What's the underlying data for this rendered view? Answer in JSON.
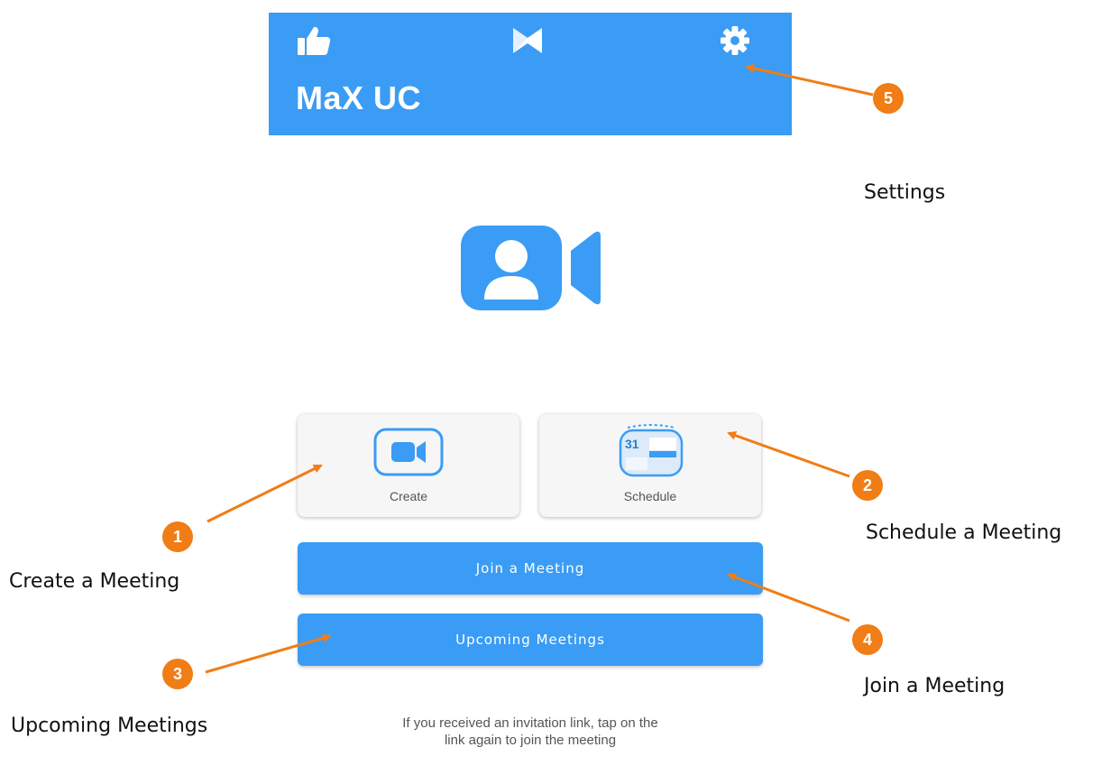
{
  "header": {
    "title": "MaX UC",
    "icons": [
      "thumbs-up-icon",
      "max-logo-icon",
      "gear-icon"
    ],
    "background": "#3a9cf4"
  },
  "hero_icon": "video-contact-icon",
  "cards": [
    {
      "label": "Create",
      "icon": "video-camera-icon"
    },
    {
      "label": "Schedule",
      "icon": "calendar-icon",
      "calendar_day": "31"
    }
  ],
  "buttons": {
    "join": "Join a Meeting",
    "upcoming": "Upcoming Meetings"
  },
  "hint": {
    "line1": "If you received an invitation link, tap on the",
    "line2": "link again to join the meeting"
  },
  "annotations": [
    {
      "number": "1",
      "label": "Create a Meeting"
    },
    {
      "number": "2",
      "label": "Schedule a Meeting"
    },
    {
      "number": "3",
      "label": "Upcoming Meetings"
    },
    {
      "number": "4",
      "label": "Join a Meeting"
    },
    {
      "number": "5",
      "label": "Settings"
    }
  ],
  "colors": {
    "accent": "#3a9cf4",
    "callout": "#f07d16"
  }
}
